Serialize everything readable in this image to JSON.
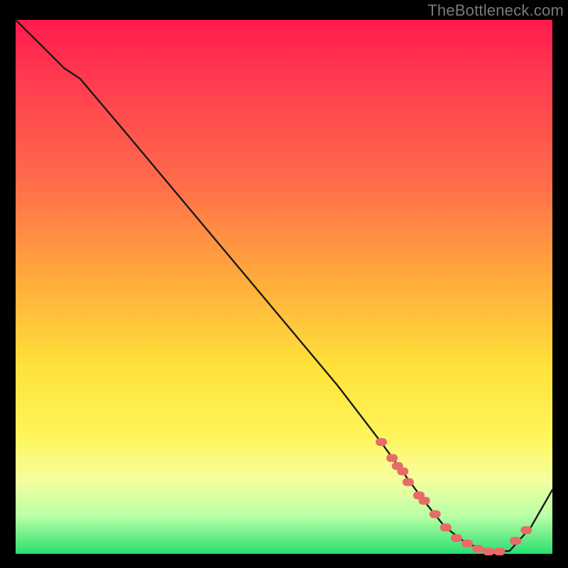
{
  "watermark": "TheBottleneck.com",
  "colors": {
    "gradient_top": "#ff1a4d",
    "gradient_mid1": "#ff6b4a",
    "gradient_mid2": "#ffe23a",
    "gradient_mid3": "#f6ff9e",
    "gradient_bottom": "#28e070",
    "curve": "#1a1a1a",
    "marker": "#e86a6a",
    "background": "#000000"
  },
  "chart_data": {
    "type": "line",
    "title": "",
    "xlabel": "",
    "ylabel": "",
    "xlim": [
      0,
      100
    ],
    "ylim": [
      0,
      100
    ],
    "series": [
      {
        "name": "curve",
        "x": [
          0,
          6,
          9,
          12,
          20,
          30,
          40,
          50,
          60,
          68,
          72,
          76,
          80,
          84,
          88,
          92,
          96,
          100
        ],
        "y": [
          100,
          94,
          91,
          89,
          79.5,
          67.5,
          55.5,
          43.5,
          31.5,
          21.0,
          15.5,
          10.0,
          5.0,
          2.0,
          0.5,
          0.5,
          5.0,
          12.0
        ]
      }
    ],
    "markers": {
      "name": "highlight-points",
      "x": [
        68,
        70,
        71,
        72,
        73,
        75,
        76,
        78,
        80,
        82,
        84,
        86,
        88,
        90,
        93,
        95
      ],
      "y": [
        21.0,
        18.0,
        16.5,
        15.5,
        13.5,
        11.0,
        10.0,
        7.5,
        5.0,
        3.0,
        2.0,
        1.0,
        0.5,
        0.5,
        2.5,
        4.5
      ]
    }
  }
}
